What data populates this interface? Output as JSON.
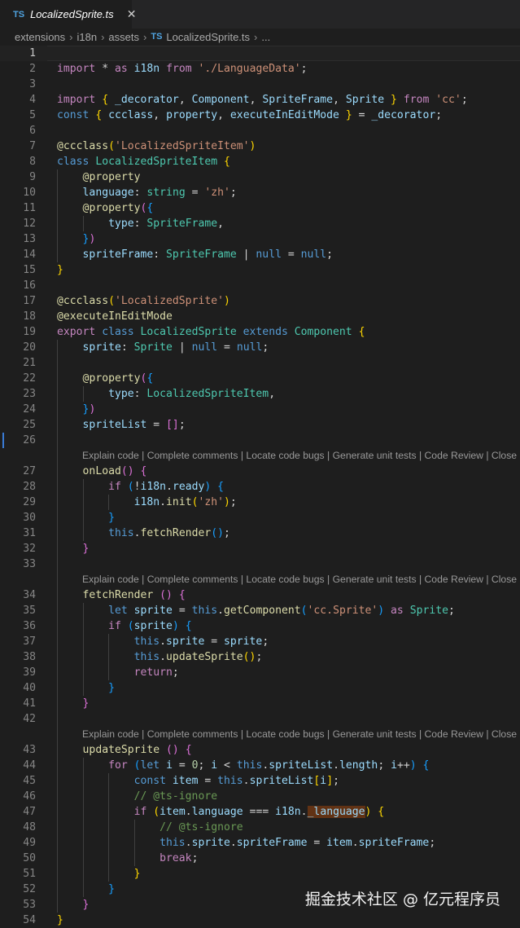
{
  "tab": {
    "badge": "TS",
    "filename": "LocalizedSprite.ts",
    "close_glyph": "✕"
  },
  "breadcrumb": [
    "extensions",
    "i18n",
    "assets",
    "LocalizedSprite.ts",
    "..."
  ],
  "codelens": "Explain code | Complete comments | Locate code bugs | Generate unit tests | Code Review | Close",
  "watermark": "掘金技术社区 @ 亿元程序员",
  "code_lines": [
    {
      "n": 1,
      "t": []
    },
    {
      "n": 2,
      "t": [
        [
          "import",
          "ctrl"
        ],
        [
          " * ",
          ""
        ],
        [
          "as",
          "ctrl"
        ],
        [
          " i18n ",
          "vr"
        ],
        [
          "from",
          "ctrl"
        ],
        [
          " ",
          ""
        ],
        [
          "'./LanguageData'",
          "str"
        ],
        [
          ";",
          ""
        ]
      ]
    },
    {
      "n": 3,
      "t": []
    },
    {
      "n": 4,
      "t": [
        [
          "import",
          "ctrl"
        ],
        [
          " ",
          ""
        ],
        [
          "{",
          "br1"
        ],
        [
          " ",
          ""
        ],
        [
          "_decorator",
          "vr"
        ],
        [
          ", ",
          ""
        ],
        [
          "Component",
          "vr"
        ],
        [
          ", ",
          ""
        ],
        [
          "SpriteFrame",
          "vr"
        ],
        [
          ", ",
          ""
        ],
        [
          "Sprite",
          "vr"
        ],
        [
          " ",
          ""
        ],
        [
          "}",
          "br1"
        ],
        [
          " ",
          ""
        ],
        [
          "from",
          "ctrl"
        ],
        [
          " ",
          ""
        ],
        [
          "'cc'",
          "str"
        ],
        [
          ";",
          ""
        ]
      ]
    },
    {
      "n": 5,
      "t": [
        [
          "const",
          "kw"
        ],
        [
          " ",
          ""
        ],
        [
          "{",
          "br1"
        ],
        [
          " ",
          ""
        ],
        [
          "ccclass",
          "vr"
        ],
        [
          ", ",
          ""
        ],
        [
          "property",
          "vr"
        ],
        [
          ", ",
          ""
        ],
        [
          "executeInEditMode",
          "vr"
        ],
        [
          " ",
          ""
        ],
        [
          "}",
          "br1"
        ],
        [
          " = ",
          ""
        ],
        [
          "_decorator",
          "vr"
        ],
        [
          ";",
          ""
        ]
      ]
    },
    {
      "n": 6,
      "t": []
    },
    {
      "n": 7,
      "t": [
        [
          "@",
          "fn"
        ],
        [
          "ccclass",
          "fn"
        ],
        [
          "(",
          "br1"
        ],
        [
          "'LocalizedSpriteItem'",
          "str"
        ],
        [
          ")",
          "br1"
        ]
      ]
    },
    {
      "n": 8,
      "t": [
        [
          "class",
          "kw"
        ],
        [
          " ",
          ""
        ],
        [
          "LocalizedSpriteItem",
          "ty"
        ],
        [
          " ",
          ""
        ],
        [
          "{",
          "br1"
        ]
      ]
    },
    {
      "n": 9,
      "t": [
        [
          "    ",
          ""
        ],
        [
          "@",
          "fn"
        ],
        [
          "property",
          "fn"
        ]
      ]
    },
    {
      "n": 10,
      "t": [
        [
          "    ",
          ""
        ],
        [
          "language",
          "vr"
        ],
        [
          ": ",
          ""
        ],
        [
          "string",
          "ty"
        ],
        [
          " = ",
          ""
        ],
        [
          "'zh'",
          "str"
        ],
        [
          ";",
          ""
        ]
      ]
    },
    {
      "n": 11,
      "t": [
        [
          "    ",
          ""
        ],
        [
          "@",
          "fn"
        ],
        [
          "property",
          "fn"
        ],
        [
          "(",
          "br2"
        ],
        [
          "{",
          "br3"
        ]
      ]
    },
    {
      "n": 12,
      "t": [
        [
          "        ",
          ""
        ],
        [
          "type",
          "vr"
        ],
        [
          ": ",
          ""
        ],
        [
          "SpriteFrame",
          "ty"
        ],
        [
          ",",
          ""
        ]
      ]
    },
    {
      "n": 13,
      "t": [
        [
          "    ",
          ""
        ],
        [
          "}",
          "br3"
        ],
        [
          ")",
          "br2"
        ]
      ]
    },
    {
      "n": 14,
      "t": [
        [
          "    ",
          ""
        ],
        [
          "spriteFrame",
          "vr"
        ],
        [
          ": ",
          ""
        ],
        [
          "SpriteFrame",
          "ty"
        ],
        [
          " | ",
          ""
        ],
        [
          "null",
          "kw"
        ],
        [
          " = ",
          ""
        ],
        [
          "null",
          "kw"
        ],
        [
          ";",
          ""
        ]
      ]
    },
    {
      "n": 15,
      "t": [
        [
          "}",
          "br1"
        ]
      ]
    },
    {
      "n": 16,
      "t": []
    },
    {
      "n": 17,
      "t": [
        [
          "@",
          "fn"
        ],
        [
          "ccclass",
          "fn"
        ],
        [
          "(",
          "br1"
        ],
        [
          "'LocalizedSprite'",
          "str"
        ],
        [
          ")",
          "br1"
        ]
      ]
    },
    {
      "n": 18,
      "t": [
        [
          "@",
          "fn"
        ],
        [
          "executeInEditMode",
          "fn"
        ]
      ]
    },
    {
      "n": 19,
      "t": [
        [
          "export",
          "ctrl"
        ],
        [
          " ",
          ""
        ],
        [
          "class",
          "kw"
        ],
        [
          " ",
          ""
        ],
        [
          "LocalizedSprite",
          "ty"
        ],
        [
          " ",
          ""
        ],
        [
          "extends",
          "kw"
        ],
        [
          " ",
          ""
        ],
        [
          "Component",
          "ty"
        ],
        [
          " ",
          ""
        ],
        [
          "{",
          "br1"
        ]
      ]
    },
    {
      "n": 20,
      "t": [
        [
          "    ",
          ""
        ],
        [
          "sprite",
          "vr"
        ],
        [
          ": ",
          ""
        ],
        [
          "Sprite",
          "ty"
        ],
        [
          " | ",
          ""
        ],
        [
          "null",
          "kw"
        ],
        [
          " = ",
          ""
        ],
        [
          "null",
          "kw"
        ],
        [
          ";",
          ""
        ]
      ]
    },
    {
      "n": 21,
      "t": []
    },
    {
      "n": 22,
      "t": [
        [
          "    ",
          ""
        ],
        [
          "@",
          "fn"
        ],
        [
          "property",
          "fn"
        ],
        [
          "(",
          "br2"
        ],
        [
          "{",
          "br3"
        ]
      ]
    },
    {
      "n": 23,
      "t": [
        [
          "        ",
          ""
        ],
        [
          "type",
          "vr"
        ],
        [
          ": ",
          ""
        ],
        [
          "LocalizedSpriteItem",
          "ty"
        ],
        [
          ",",
          ""
        ]
      ]
    },
    {
      "n": 24,
      "t": [
        [
          "    ",
          ""
        ],
        [
          "}",
          "br3"
        ],
        [
          ")",
          "br2"
        ]
      ]
    },
    {
      "n": 25,
      "t": [
        [
          "    ",
          ""
        ],
        [
          "spriteList",
          "vr"
        ],
        [
          " = ",
          ""
        ],
        [
          "[]",
          "br2"
        ],
        [
          ";",
          ""
        ]
      ]
    },
    {
      "n": 26,
      "t": []
    },
    {
      "n": 27,
      "t": [
        [
          "    ",
          ""
        ],
        [
          "onLoad",
          "fn"
        ],
        [
          "()",
          "br2"
        ],
        [
          " ",
          ""
        ],
        [
          "{",
          "br2"
        ]
      ]
    },
    {
      "n": 28,
      "t": [
        [
          "        ",
          ""
        ],
        [
          "if",
          "ctrl"
        ],
        [
          " ",
          ""
        ],
        [
          "(",
          "br3"
        ],
        [
          "!",
          ""
        ],
        [
          "i18n",
          "vr"
        ],
        [
          ".",
          ""
        ],
        [
          "ready",
          "vr"
        ],
        [
          ")",
          "br3"
        ],
        [
          " ",
          ""
        ],
        [
          "{",
          "br3"
        ]
      ]
    },
    {
      "n": 29,
      "t": [
        [
          "            ",
          ""
        ],
        [
          "i18n",
          "vr"
        ],
        [
          ".",
          ""
        ],
        [
          "init",
          "fn"
        ],
        [
          "(",
          "br1"
        ],
        [
          "'zh'",
          "str"
        ],
        [
          ")",
          "br1"
        ],
        [
          ";",
          ""
        ]
      ]
    },
    {
      "n": 30,
      "t": [
        [
          "        ",
          ""
        ],
        [
          "}",
          "br3"
        ]
      ]
    },
    {
      "n": 31,
      "t": [
        [
          "        ",
          ""
        ],
        [
          "this",
          "kw"
        ],
        [
          ".",
          ""
        ],
        [
          "fetchRender",
          "fn"
        ],
        [
          "()",
          "br3"
        ],
        [
          ";",
          ""
        ]
      ]
    },
    {
      "n": 32,
      "t": [
        [
          "    ",
          ""
        ],
        [
          "}",
          "br2"
        ]
      ]
    },
    {
      "n": 33,
      "t": []
    },
    {
      "n": 34,
      "t": [
        [
          "    ",
          ""
        ],
        [
          "fetchRender",
          "fn"
        ],
        [
          " ",
          ""
        ],
        [
          "()",
          "br2"
        ],
        [
          " ",
          ""
        ],
        [
          "{",
          "br2"
        ]
      ]
    },
    {
      "n": 35,
      "t": [
        [
          "        ",
          ""
        ],
        [
          "let",
          "kw"
        ],
        [
          " ",
          ""
        ],
        [
          "sprite",
          "vr"
        ],
        [
          " = ",
          ""
        ],
        [
          "this",
          "kw"
        ],
        [
          ".",
          ""
        ],
        [
          "getComponent",
          "fn"
        ],
        [
          "(",
          "br3"
        ],
        [
          "'cc.Sprite'",
          "str"
        ],
        [
          ")",
          "br3"
        ],
        [
          " ",
          ""
        ],
        [
          "as",
          "ctrl"
        ],
        [
          " ",
          ""
        ],
        [
          "Sprite",
          "ty"
        ],
        [
          ";",
          ""
        ]
      ]
    },
    {
      "n": 36,
      "t": [
        [
          "        ",
          ""
        ],
        [
          "if",
          "ctrl"
        ],
        [
          " ",
          ""
        ],
        [
          "(",
          "br3"
        ],
        [
          "sprite",
          "vr"
        ],
        [
          ")",
          "br3"
        ],
        [
          " ",
          ""
        ],
        [
          "{",
          "br3"
        ]
      ]
    },
    {
      "n": 37,
      "t": [
        [
          "            ",
          ""
        ],
        [
          "this",
          "kw"
        ],
        [
          ".",
          ""
        ],
        [
          "sprite",
          "vr"
        ],
        [
          " = ",
          ""
        ],
        [
          "sprite",
          "vr"
        ],
        [
          ";",
          ""
        ]
      ]
    },
    {
      "n": 38,
      "t": [
        [
          "            ",
          ""
        ],
        [
          "this",
          "kw"
        ],
        [
          ".",
          ""
        ],
        [
          "updateSprite",
          "fn"
        ],
        [
          "()",
          "br1"
        ],
        [
          ";",
          ""
        ]
      ]
    },
    {
      "n": 39,
      "t": [
        [
          "            ",
          ""
        ],
        [
          "return",
          "ctrl"
        ],
        [
          ";",
          ""
        ]
      ]
    },
    {
      "n": 40,
      "t": [
        [
          "        ",
          ""
        ],
        [
          "}",
          "br3"
        ]
      ]
    },
    {
      "n": 41,
      "t": [
        [
          "    ",
          ""
        ],
        [
          "}",
          "br2"
        ]
      ]
    },
    {
      "n": 42,
      "t": []
    },
    {
      "n": 43,
      "t": [
        [
          "    ",
          ""
        ],
        [
          "updateSprite",
          "fn"
        ],
        [
          " ",
          ""
        ],
        [
          "()",
          "br2"
        ],
        [
          " ",
          ""
        ],
        [
          "{",
          "br2"
        ]
      ]
    },
    {
      "n": 44,
      "t": [
        [
          "        ",
          ""
        ],
        [
          "for",
          "ctrl"
        ],
        [
          " ",
          ""
        ],
        [
          "(",
          "br3"
        ],
        [
          "let",
          "kw"
        ],
        [
          " ",
          ""
        ],
        [
          "i",
          "vr"
        ],
        [
          " = ",
          ""
        ],
        [
          "0",
          "num"
        ],
        [
          "; ",
          ""
        ],
        [
          "i",
          "vr"
        ],
        [
          " < ",
          ""
        ],
        [
          "this",
          "kw"
        ],
        [
          ".",
          ""
        ],
        [
          "spriteList",
          "vr"
        ],
        [
          ".",
          ""
        ],
        [
          "length",
          "vr"
        ],
        [
          "; ",
          ""
        ],
        [
          "i",
          "vr"
        ],
        [
          "++",
          ""
        ],
        [
          ")",
          "br3"
        ],
        [
          " ",
          ""
        ],
        [
          "{",
          "br3"
        ]
      ]
    },
    {
      "n": 45,
      "t": [
        [
          "            ",
          ""
        ],
        [
          "const",
          "kw"
        ],
        [
          " ",
          ""
        ],
        [
          "item",
          "vr"
        ],
        [
          " = ",
          ""
        ],
        [
          "this",
          "kw"
        ],
        [
          ".",
          ""
        ],
        [
          "spriteList",
          "vr"
        ],
        [
          "[",
          "br1"
        ],
        [
          "i",
          "vr"
        ],
        [
          "]",
          "br1"
        ],
        [
          ";",
          ""
        ]
      ]
    },
    {
      "n": 46,
      "t": [
        [
          "            ",
          ""
        ],
        [
          "// @ts-ignore",
          "cmt"
        ]
      ]
    },
    {
      "n": 47,
      "t": [
        [
          "            ",
          ""
        ],
        [
          "if",
          "ctrl"
        ],
        [
          " ",
          ""
        ],
        [
          "(",
          "br1"
        ],
        [
          "item",
          "vr"
        ],
        [
          ".",
          ""
        ],
        [
          "language",
          "vr"
        ],
        [
          " === ",
          ""
        ],
        [
          "i18n",
          "vr"
        ],
        [
          ".",
          ""
        ],
        [
          "_language",
          "vr hl"
        ],
        [
          ")",
          "br1"
        ],
        [
          " ",
          ""
        ],
        [
          "{",
          "br1"
        ]
      ]
    },
    {
      "n": 48,
      "t": [
        [
          "                ",
          ""
        ],
        [
          "// @ts-ignore",
          "cmt"
        ]
      ]
    },
    {
      "n": 49,
      "t": [
        [
          "                ",
          ""
        ],
        [
          "this",
          "kw"
        ],
        [
          ".",
          ""
        ],
        [
          "sprite",
          "vr"
        ],
        [
          ".",
          ""
        ],
        [
          "spriteFrame",
          "vr"
        ],
        [
          " = ",
          ""
        ],
        [
          "item",
          "vr"
        ],
        [
          ".",
          ""
        ],
        [
          "spriteFrame",
          "vr"
        ],
        [
          ";",
          ""
        ]
      ]
    },
    {
      "n": 50,
      "t": [
        [
          "                ",
          ""
        ],
        [
          "break",
          "ctrl"
        ],
        [
          ";",
          ""
        ]
      ]
    },
    {
      "n": 51,
      "t": [
        [
          "            ",
          ""
        ],
        [
          "}",
          "br1"
        ]
      ]
    },
    {
      "n": 52,
      "t": [
        [
          "        ",
          ""
        ],
        [
          "}",
          "br3"
        ]
      ]
    },
    {
      "n": 53,
      "t": [
        [
          "    ",
          ""
        ],
        [
          "}",
          "br2"
        ]
      ]
    },
    {
      "n": 54,
      "t": [
        [
          "}",
          "br1"
        ]
      ]
    }
  ]
}
